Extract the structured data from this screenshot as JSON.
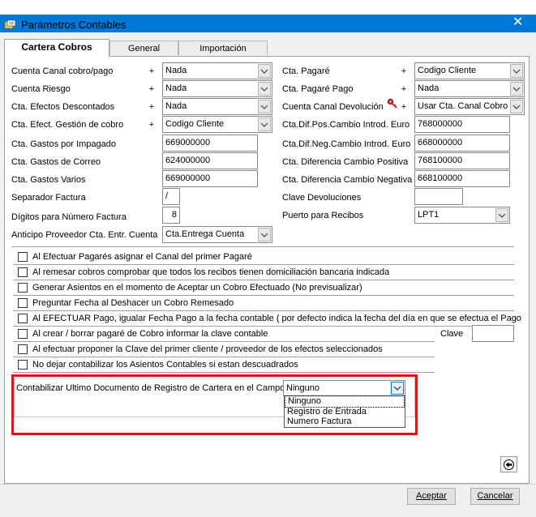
{
  "window": {
    "title": "Parámetros Contables",
    "close_glyph": "✕"
  },
  "tabs": [
    "Cartera Cobros",
    "General",
    "Importación"
  ],
  "left_rows": [
    {
      "label": "Cuenta Canal cobro/pago",
      "plus": "+",
      "value": "Nada",
      "combo": true
    },
    {
      "label": "Cuenta Riesgo",
      "plus": "+",
      "value": "Nada",
      "combo": true
    },
    {
      "label": "Cta. Efectos Descontados",
      "plus": "+",
      "value": "Nada",
      "combo": true
    },
    {
      "label": "Cta. Efect. Gestión de cobro",
      "plus": "+",
      "value": "Codigo Cliente",
      "combo": true
    },
    {
      "label": "Cta. Gastos por Impagado",
      "value": "669000000"
    },
    {
      "label": "Cta. Gastos de Correo",
      "value": "624000000"
    },
    {
      "label": "Cta. Gastos Varios",
      "value": "669000000"
    },
    {
      "label": "Separador Factura",
      "value": "/"
    },
    {
      "label": "Dígitos para Número Factura",
      "value": "8"
    },
    {
      "label": "Anticipo Proveedor Cta. Entr. Cuenta",
      "value": "Cta.Entrega Cuenta",
      "combo": true
    }
  ],
  "right_rows": [
    {
      "label": "Cta. Pagaré",
      "plus": "+",
      "value": "Codigo Cliente",
      "combo": true
    },
    {
      "label": "Cta. Pagaré Pago",
      "plus": "+",
      "value": "Nada",
      "combo": true
    },
    {
      "label": "Cuenta Canal Devolución",
      "plus": "+",
      "value": "Usar Cta. Canal Cobro",
      "combo": true
    },
    {
      "label": "Cta.Dif.Pos.Cambio Introd. Euro",
      "value": "768000000"
    },
    {
      "label": "Cta.Dif.Neg.Cambio Introd. Euro",
      "value": "668000000"
    },
    {
      "label": "Cta. Diferencia Cambio Positiva",
      "value": "768100000"
    },
    {
      "label": "Cta. Diferencia Cambio Negativa",
      "value": "668100000"
    },
    {
      "label": "Clave Devoluciones",
      "value": ""
    },
    {
      "label": "Puerto para Recibos",
      "value": "LPT1",
      "combo": true
    }
  ],
  "checkboxes": [
    "Al Efectuar Pagarés asignar el Canal del primer Pagaré",
    "Al remesar cobros comprobar que todos los recibos tienen domiciliación bancaria indicada",
    "Generar Asientos en el momento de Aceptar un Cobro Efectuado (No previsualizar)",
    "Preguntar Fecha al Deshacer un Cobro Remesado",
    "Al EFECTUAR Pago, igualar Fecha Pago a la fecha contable ( por defecto indica la fecha del día en que se efectua el Pago",
    "Al crear / borrar pagaré de Cobro informar la clave contable",
    "Al efectuar proponer la Clave del primer cliente / proveedor de los efectos seleccionados",
    "No dejar contabilizar los Asientos Contables si estan descuadrados"
  ],
  "clave": {
    "label": "Clave",
    "value": ""
  },
  "contabilizar": {
    "label": "Contabilizar Ultimo Documento de Registro de Cartera en el Campo:",
    "selected": "Ninguno",
    "options": [
      "Ninguno",
      "Registro de Entrada",
      "Numero Factura"
    ]
  },
  "buttons": {
    "accept": "Aceptar",
    "cancel": "Cancelar"
  },
  "colors": {
    "title_bar": "#0078d7",
    "highlight": "#e0141b"
  },
  "icons": [
    "app-icon",
    "close-icon",
    "chevron-down-icon",
    "red-key-icon",
    "back-arrow-icon"
  ]
}
